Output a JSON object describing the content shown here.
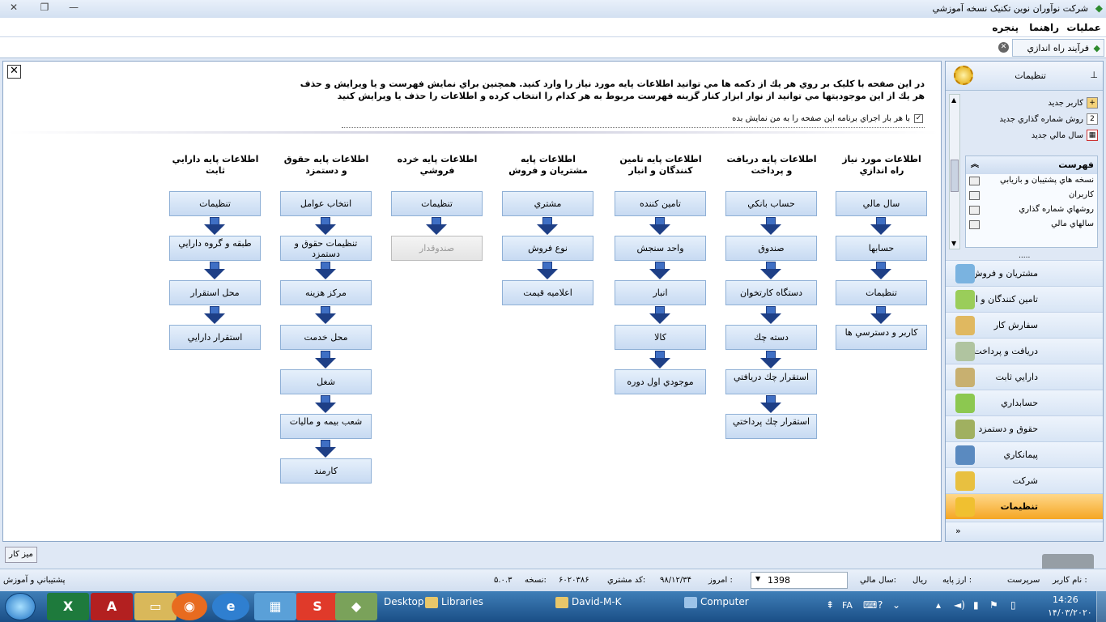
{
  "window": {
    "title": "شرکت نوآوران نوین تکنیک نسخه آموزشي",
    "controls": {
      "close": "✕",
      "restore": "❐",
      "minimize": "—"
    }
  },
  "menu": [
    "عمليات",
    "راهنما",
    "پنجره"
  ],
  "doc_tab": {
    "label": "فرآیند راه اندازي",
    "close": "✕"
  },
  "intro": {
    "line1": "در اين صفحه با کليک بر روي هر يك از دكمه ها مي توانيد اطلاعات پايه مورد نياز را وارد كنيد. همچنين براي نمايش فهرست و يا ويرايش و حذف",
    "line2": "هر يك از اين موجوديتها مي توانيد از نوار ابزار كنار گزينه فهرست مربوط به هر كدام را انتخاب كرده و اطلاعات را حذف يا ويرايش كنيد",
    "checkbox_label": "با هر بار اجراي برنامه اين صفحه را به من نمايش بده",
    "checkbox_checked": true,
    "checkbox_mark": "✓"
  },
  "close_mark": "✕",
  "columns": [
    {
      "title": "اطلاعات مورد نياز راه اندازي",
      "buttons": [
        "سال مالي",
        "حسابها",
        "تنظيمات",
        "كاربر و دسترسي ها"
      ]
    },
    {
      "title": "اطلاعات پايه دريافت و پرداخت",
      "buttons": [
        "حساب بانكي",
        "صندوق",
        "دستگاه كارتخوان",
        "دسته چك",
        "استقرار چك دريافتي",
        "استقرار چك پرداختي"
      ]
    },
    {
      "title": "اطلاعات پايه تامين كنندگان و انبار",
      "buttons": [
        "تامين كننده",
        "واحد سنجش",
        "انبار",
        "كالا",
        "موجودي اول دوره"
      ]
    },
    {
      "title": "اطلاعات پايه مشتريان و فروش",
      "buttons": [
        "مشتري",
        "نوع فروش",
        "اعلاميه قيمت"
      ]
    },
    {
      "title": "اطلاعات پايه خرده فروشي",
      "buttons": [
        "تنظيمات",
        "صندوقدار"
      ],
      "disabled": [
        1
      ]
    },
    {
      "title": "اطلاعات پايه حقوق و دستمزد",
      "buttons": [
        "انتخاب عوامل",
        "تنظيمات حقوق و دستمزد",
        "مركز هزينه",
        "محل خدمت",
        "شغل",
        "شعب بيمه و ماليات",
        "كارمند"
      ]
    },
    {
      "title": "اطلاعات پايه دارايي ثابت",
      "buttons": [
        "تنظيمات",
        "طبقه و گروه دارايي",
        "محل استقرار",
        "استقرار دارايي"
      ]
    }
  ],
  "sidebar": {
    "title": "تنظيمات",
    "pin": "⊥",
    "new_items": [
      "كاربر جديد",
      "روش شماره گذاري جديد",
      "سال مالي جديد"
    ],
    "list_title": "فهرست",
    "list_chevron": "︽",
    "list_items": [
      "نسخه هاي پشتيبان و بازيابي",
      "كاربران",
      "روشهاي شماره گذاري",
      "سالهاي مالي"
    ],
    "dots": ".....",
    "nav": [
      "مشتريان و فروش",
      "تامين كنندگان و انبار",
      "سفارش كار",
      "دريافت و پرداخت",
      "دارايي ثابت",
      "حسابداري",
      "حقوق و دستمزد",
      "پيمانكاري",
      "شركت",
      "تنظيمات"
    ],
    "active_nav": "تنظيمات",
    "bottom_chevron": "»"
  },
  "desk_button": "ميز كار",
  "status": {
    "user_label": "نام كاربر :",
    "user": "سرپرست",
    "currency_label": "ارز پايه :",
    "currency": "ريال",
    "fiscal_label": "سال مالي:",
    "fiscal_year": "1398",
    "today_label": "امروز :",
    "today": "۹۸/۱۲/۳۴",
    "customer_label": "كد مشتري:",
    "customer_code": "۶۰۲۰۳۸۶",
    "version_label": "نسخه:",
    "version": "۵.۰.۳",
    "support": "پشتيباني و آموزش"
  },
  "taskbar": {
    "windows": [
      "Desktop",
      "Libraries",
      "David-M-K",
      "Computer"
    ],
    "lang": "FA",
    "time": "14:26",
    "date": "۱۴/۰۳/۲۰۲۰"
  },
  "colors": {
    "accent": "#f5a623",
    "button": "#c7daf2",
    "arrow": "#3f6fc4",
    "taskbar": "#1a4e86"
  }
}
